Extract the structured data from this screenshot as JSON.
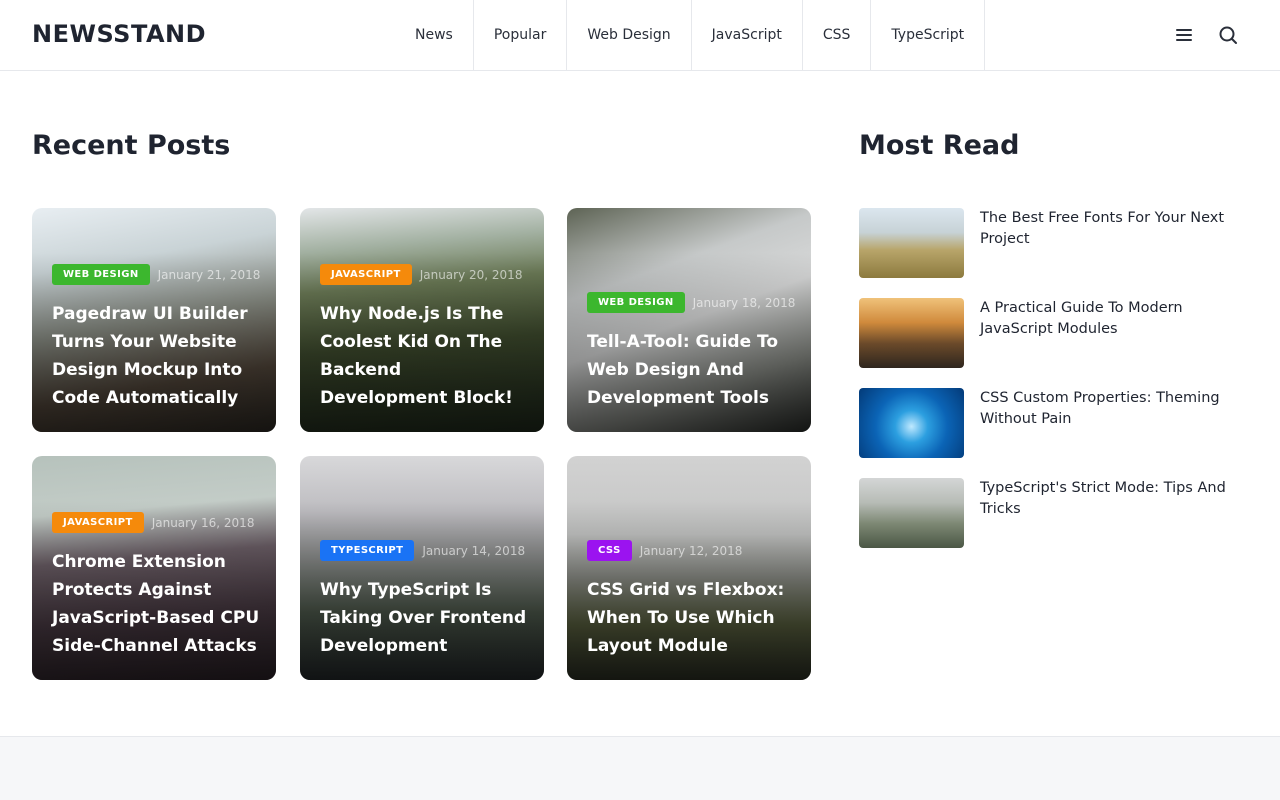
{
  "header": {
    "logo": "NEWSSTAND",
    "nav": [
      "News",
      "Popular",
      "Web Design",
      "JavaScript",
      "CSS",
      "TypeScript"
    ]
  },
  "icons": {
    "menu": "hamburger-menu-icon",
    "search": "search-icon"
  },
  "recent": {
    "title": "Recent Posts",
    "posts": [
      {
        "category": "WEB DESIGN",
        "color": "#3cb72e",
        "date": "January 21, 2018",
        "title": "Pagedraw UI Builder Turns Your Website Design Mockup Into Code Automatically"
      },
      {
        "category": "JAVASCRIPT",
        "color": "#f58a0b",
        "date": "January 20, 2018",
        "title": "Why Node.js Is The Coolest Kid On The Backend Development Block!"
      },
      {
        "category": "WEB DESIGN",
        "color": "#3cb72e",
        "date": "January 18, 2018",
        "title": "Tell-A-Tool: Guide To Web Design And Development Tools"
      },
      {
        "category": "JAVASCRIPT",
        "color": "#f58a0b",
        "date": "January 16, 2018",
        "title": "Chrome Extension Protects Against JavaScript-Based CPU Side-Channel Attacks"
      },
      {
        "category": "TYPESCRIPT",
        "color": "#1a73f5",
        "date": "January 14, 2018",
        "title": "Why TypeScript Is Taking Over Frontend Development"
      },
      {
        "category": "CSS",
        "color": "#9b13f0",
        "date": "January 12, 2018",
        "title": "CSS Grid vs Flexbox: When To Use Which Layout Module"
      }
    ]
  },
  "most_read": {
    "title": "Most Read",
    "items": [
      {
        "title": "The Best Free Fonts For Your Next Project"
      },
      {
        "title": "A Practical Guide To Modern JavaScript Modules"
      },
      {
        "title": "CSS Custom Properties: Theming Without Pain"
      },
      {
        "title": "TypeScript's Strict Mode: Tips And Tricks"
      }
    ]
  }
}
